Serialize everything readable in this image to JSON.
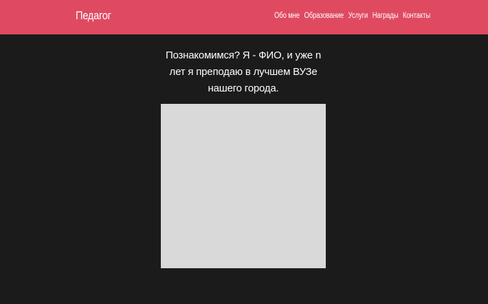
{
  "header": {
    "logo": "Педагог",
    "nav": [
      {
        "label": "Обо мне"
      },
      {
        "label": "Образование"
      },
      {
        "label": "Услуги"
      },
      {
        "label": "Награды"
      },
      {
        "label": "Контакты"
      }
    ],
    "background_color": "#df4a61"
  },
  "main": {
    "intro_lines": [
      "Познакомимся? Я - ФИО, и уже n",
      "лет я преподаю в лучшем ВУЗе",
      "нашего города."
    ],
    "photo_placeholder_color": "#d9d9d9",
    "background_color": "#1b1b1b"
  }
}
